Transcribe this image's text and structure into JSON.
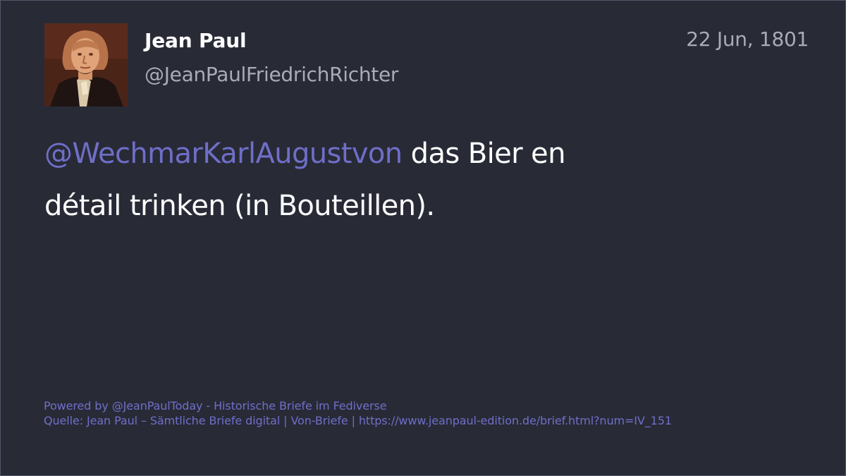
{
  "post": {
    "display_name": "Jean Paul",
    "handle": "@JeanPaulFriedrichRichter",
    "date": "22 Jun, 1801",
    "mention": "@WechmarKarlAugustvon",
    "text": " das Bier en détail trinken (in Bouteillen)."
  },
  "footer": {
    "powered_by": "Powered by @JeanPaulToday - Historische Briefe im Fediverse",
    "source": "Quelle: Jean Paul – Sämtliche Briefe digital | Von-Briefe | https://www.jeanpaul-edition.de/brief.html?num=IV_151"
  },
  "colors": {
    "background": "#282a36",
    "text": "#ffffff",
    "muted": "#a9abb6",
    "accent": "#6f6fc8"
  },
  "icons": {
    "avatar": "portrait-avatar-icon"
  }
}
